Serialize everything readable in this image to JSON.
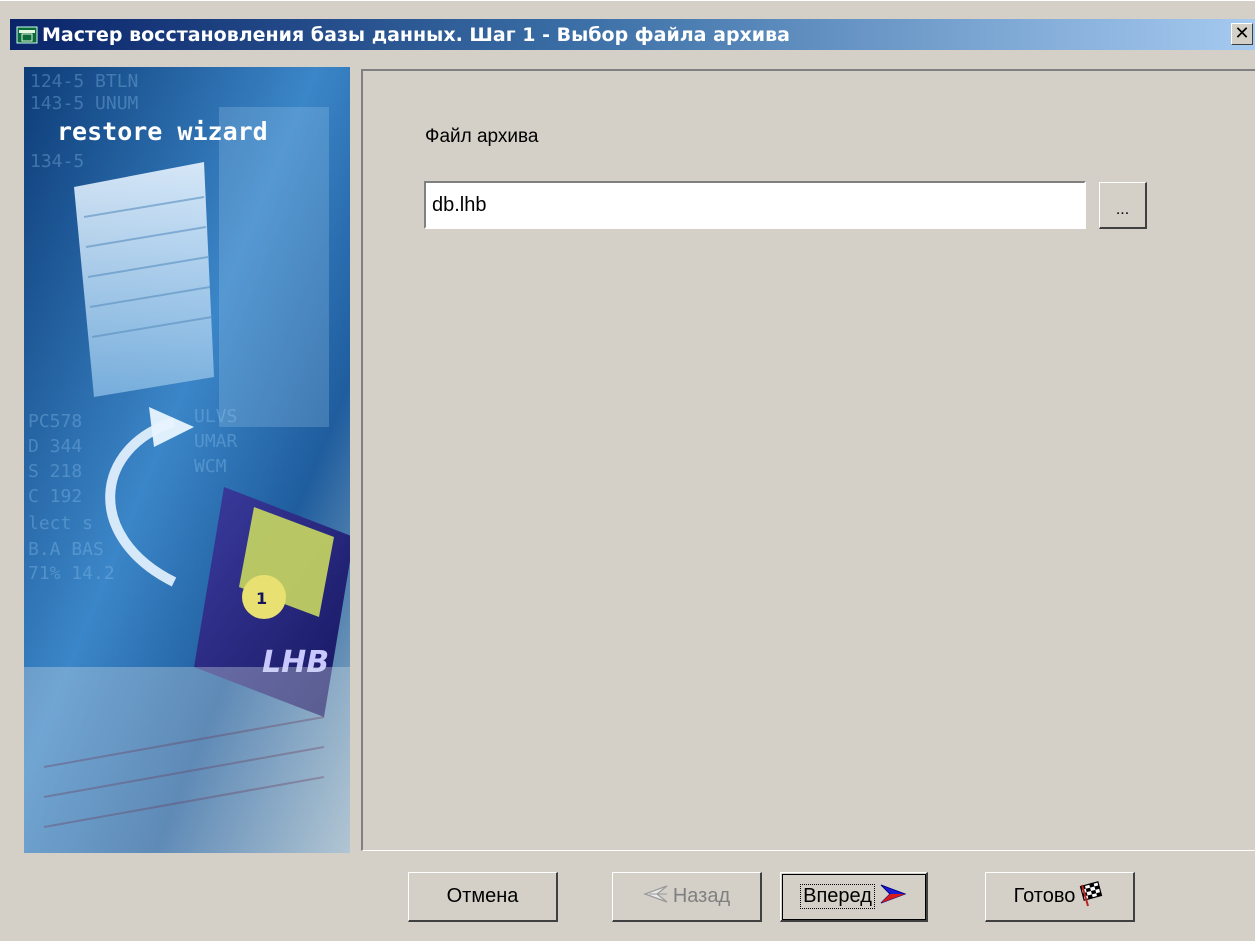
{
  "window": {
    "title": "Мастер восстановления базы данных. Шаг 1 - Выбор файла архива",
    "close_label": "✕"
  },
  "side_image": {
    "heading": "restore wizard",
    "disk_label": "LHB",
    "disk_number": "1"
  },
  "form": {
    "archive_label": "Файл архива",
    "archive_value": "db.lhb",
    "browse_label": "..."
  },
  "buttons": {
    "cancel": "Отмена",
    "back": "Назад",
    "next": "Вперед",
    "finish": "Готово"
  },
  "colors": {
    "titlebar_start": "#0a246a",
    "titlebar_end": "#a6caf0",
    "face": "#d4d0c8"
  }
}
